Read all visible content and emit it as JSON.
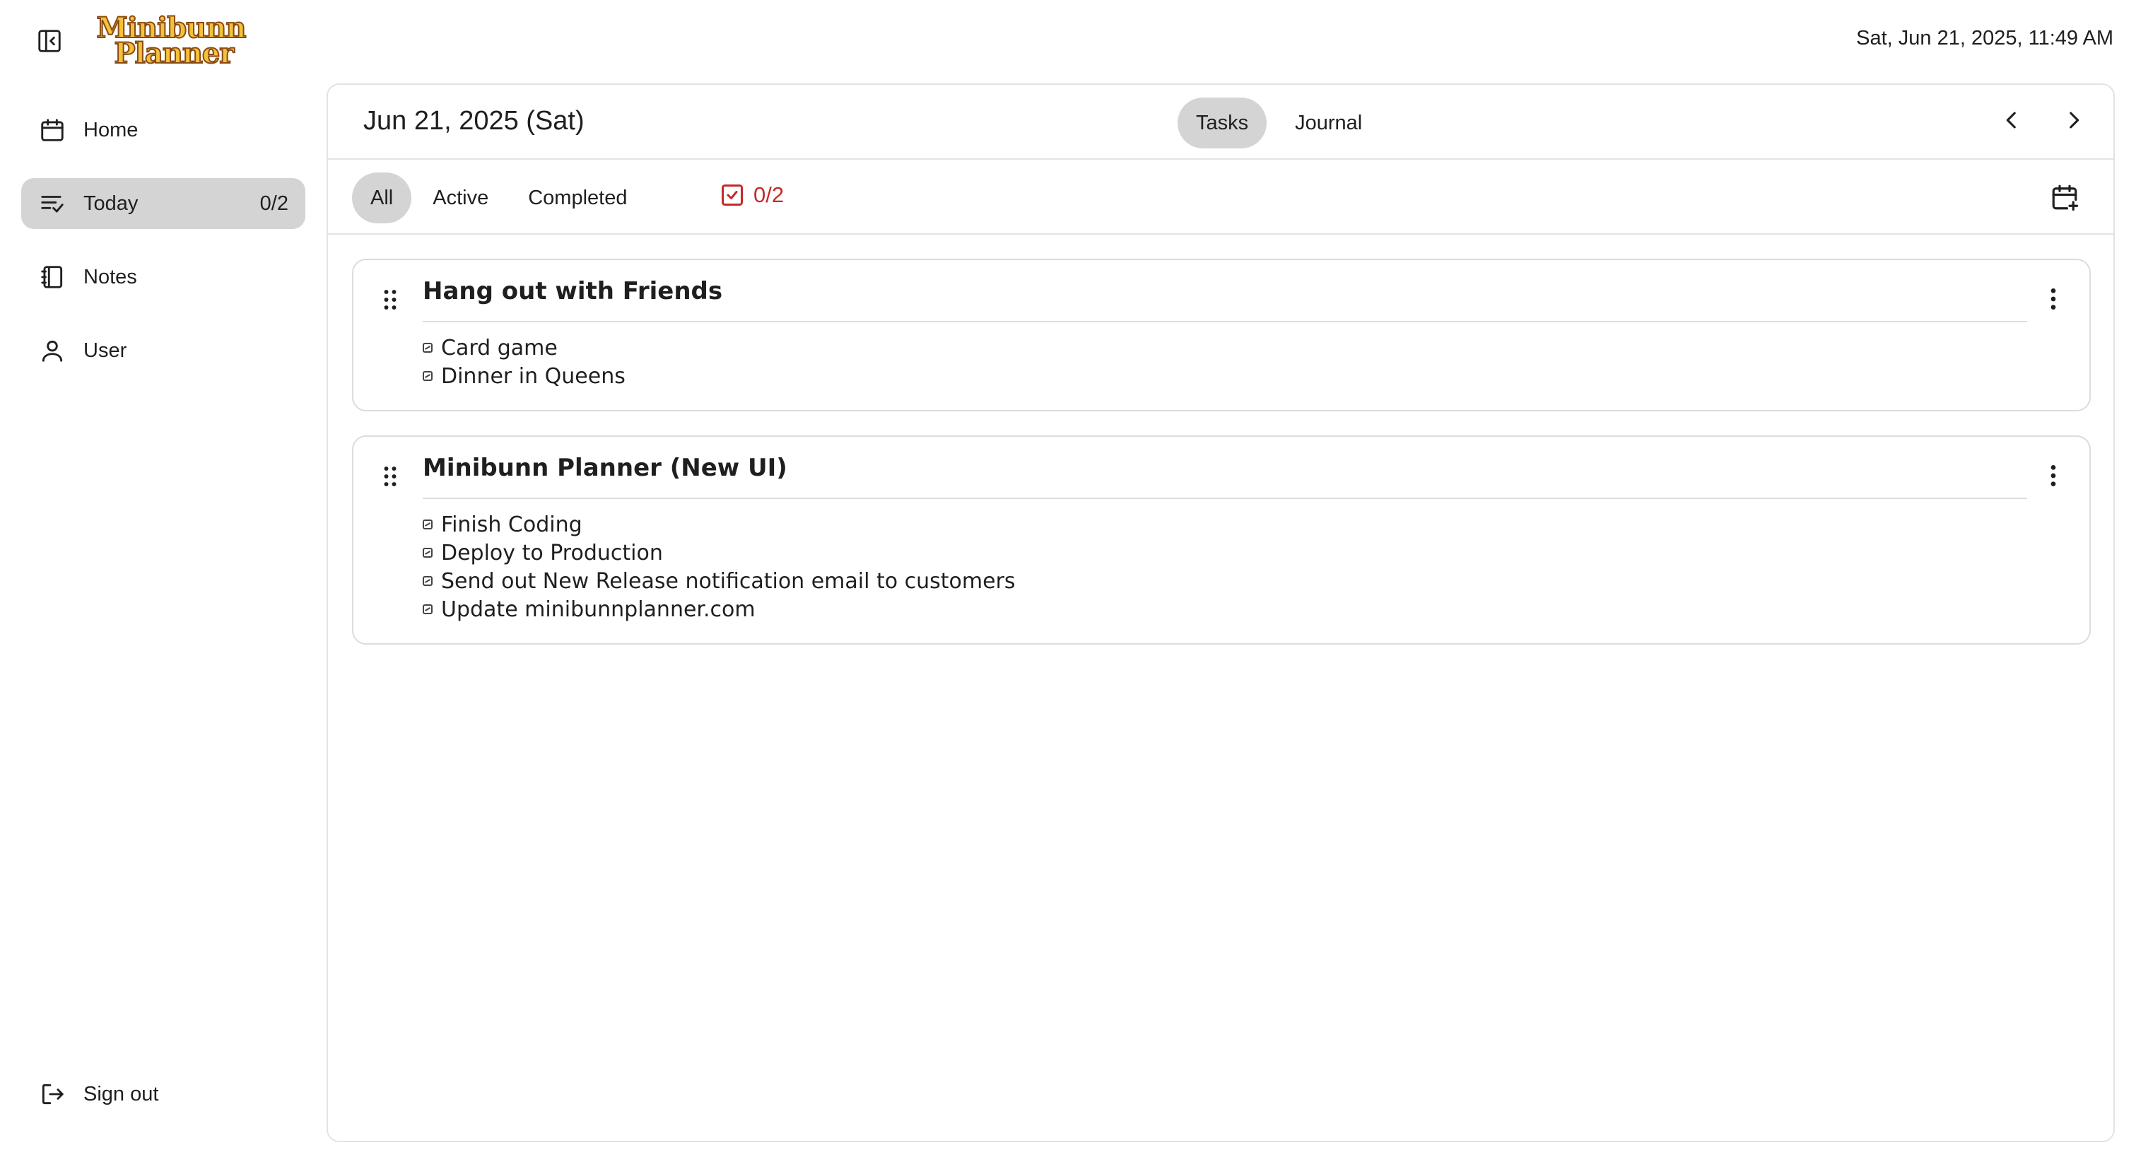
{
  "app": {
    "logo_line1": "Minibunn",
    "logo_line2": "Planner",
    "clock": "Sat, Jun 21, 2025, 11:49 AM"
  },
  "sidebar": {
    "items": [
      {
        "label": "Home",
        "icon": "calendar-icon",
        "count": ""
      },
      {
        "label": "Today",
        "icon": "list-check-icon",
        "count": "0/2"
      },
      {
        "label": "Notes",
        "icon": "notebook-icon",
        "count": ""
      },
      {
        "label": "User",
        "icon": "user-icon",
        "count": ""
      }
    ],
    "active_index": 1,
    "signout_label": "Sign out"
  },
  "header": {
    "date_title": "Jun 21, 2025 (Sat)",
    "tabs": [
      "Tasks",
      "Journal"
    ],
    "active_tab": "Tasks"
  },
  "filters": {
    "options": [
      "All",
      "Active",
      "Completed"
    ],
    "active": "All",
    "progress": "0/2"
  },
  "tasks": [
    {
      "title": "Hang out with Friends",
      "subtasks": [
        "Card game",
        "Dinner in Queens"
      ]
    },
    {
      "title": "Minibunn Planner (New UI)",
      "subtasks": [
        "Finish Coding",
        "Deploy to Production",
        "Send out New Release notification email to customers",
        "Update minibunnplanner.com"
      ]
    }
  ],
  "colors": {
    "accent_red": "#c62828",
    "active_pill": "#d4d4d4",
    "logo_fill": "#f3c23a",
    "logo_stroke": "#8a4a12"
  }
}
